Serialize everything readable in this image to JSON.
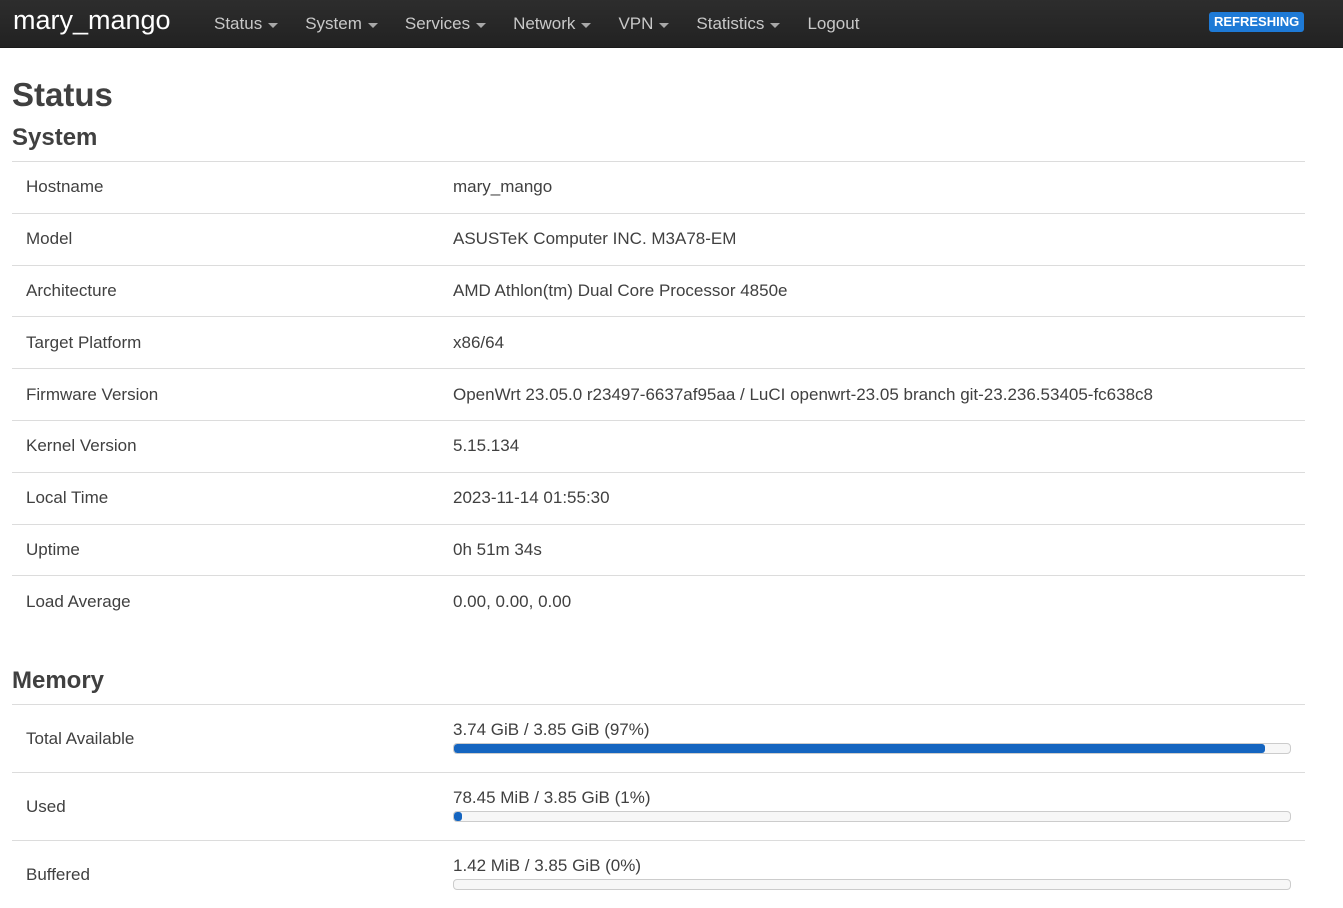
{
  "header": {
    "brand": "mary_mango",
    "menu": [
      {
        "label": "Status",
        "dropdown": true
      },
      {
        "label": "System",
        "dropdown": true
      },
      {
        "label": "Services",
        "dropdown": true
      },
      {
        "label": "Network",
        "dropdown": true
      },
      {
        "label": "VPN",
        "dropdown": true
      },
      {
        "label": "Statistics",
        "dropdown": true
      },
      {
        "label": "Logout",
        "dropdown": false
      }
    ],
    "badge": "REFRESHING"
  },
  "page": {
    "title": "Status"
  },
  "system": {
    "title": "System",
    "rows": [
      {
        "label": "Hostname",
        "value": "mary_mango"
      },
      {
        "label": "Model",
        "value": "ASUSTeK Computer INC. M3A78-EM"
      },
      {
        "label": "Architecture",
        "value": "AMD Athlon(tm) Dual Core Processor 4850e"
      },
      {
        "label": "Target Platform",
        "value": "x86/64"
      },
      {
        "label": "Firmware Version",
        "value": "OpenWrt 23.05.0 r23497-6637af95aa / LuCI openwrt-23.05 branch git-23.236.53405-fc638c8"
      },
      {
        "label": "Kernel Version",
        "value": "5.15.134"
      },
      {
        "label": "Local Time",
        "value": "2023-11-14 01:55:30"
      },
      {
        "label": "Uptime",
        "value": "0h 51m 34s"
      },
      {
        "label": "Load Average",
        "value": "0.00, 0.00, 0.00"
      }
    ]
  },
  "memory": {
    "title": "Memory",
    "rows": [
      {
        "label": "Total Available",
        "value": "3.74 GiB / 3.85 GiB (97%)",
        "percent": 97
      },
      {
        "label": "Used",
        "value": "78.45 MiB / 3.85 GiB (1%)",
        "percent": 1
      },
      {
        "label": "Buffered",
        "value": "1.42 MiB / 3.85 GiB (0%)",
        "percent": 0
      }
    ]
  },
  "colors": {
    "navbar": "#222222",
    "badge": "#1e7ad6",
    "progress": "#1565c0"
  }
}
